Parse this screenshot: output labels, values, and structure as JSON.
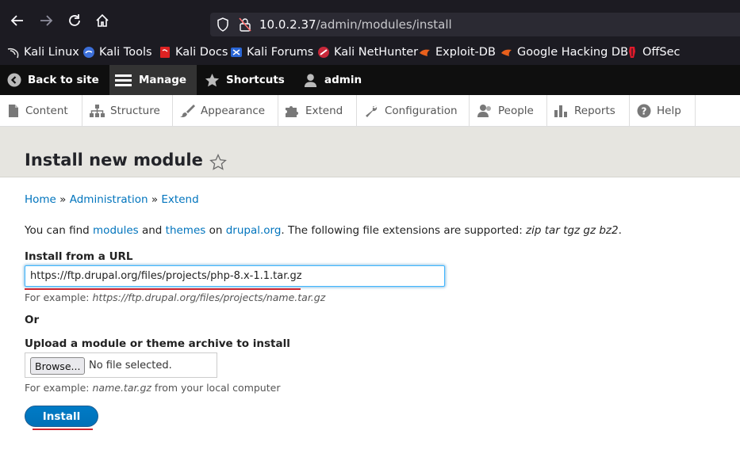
{
  "browser": {
    "url_host": "10.0.2.37",
    "url_path": "/admin/modules/install"
  },
  "bookmarks": [
    {
      "label": "Kali Linux",
      "icon": "kali-dragon-icon"
    },
    {
      "label": "Kali Tools",
      "icon": "kali-tools-icon"
    },
    {
      "label": "Kali Docs",
      "icon": "kali-docs-icon"
    },
    {
      "label": "Kali Forums",
      "icon": "kali-forums-icon"
    },
    {
      "label": "Kali NetHunter",
      "icon": "nethunter-icon"
    },
    {
      "label": "Exploit-DB",
      "icon": "exploit-db-icon"
    },
    {
      "label": "Google Hacking DB",
      "icon": "ghdb-icon"
    },
    {
      "label": "OffSec",
      "icon": "offsec-icon"
    }
  ],
  "admin_bar": {
    "back": "Back to site",
    "manage": "Manage",
    "shortcuts": "Shortcuts",
    "user": "admin"
  },
  "tray": [
    "Content",
    "Structure",
    "Appearance",
    "Extend",
    "Configuration",
    "People",
    "Reports",
    "Help"
  ],
  "page": {
    "title": "Install new module",
    "breadcrumb": [
      "Home",
      "Administration",
      "Extend"
    ],
    "breadcrumb_sep": "»",
    "intro": {
      "t1": "You can find ",
      "modules": "modules",
      "t2": " and ",
      "themes": "themes",
      "t3": " on ",
      "drupal": "drupal.org",
      "t4": ". The following file extensions are supported: ",
      "ext": "zip tar tgz gz bz2",
      "t5": "."
    },
    "url_label": "Install from a URL",
    "url_value": "https://ftp.drupal.org/files/projects/php-8.x-1.1.tar.gz",
    "url_hint_prefix": "For example: ",
    "url_hint_example": "https://ftp.drupal.org/files/projects/name.tar.gz",
    "or": "Or",
    "upload_label": "Upload a module or theme archive to install",
    "browse": "Browse...",
    "file_status": "No file selected.",
    "upload_hint_prefix": "For example: ",
    "upload_hint_example": "name.tar.gz",
    "upload_hint_suffix": " from your local computer",
    "install": "Install"
  },
  "colors": {
    "link": "#0074bd",
    "button": "#0071b8",
    "annotation": "#d0262e"
  }
}
